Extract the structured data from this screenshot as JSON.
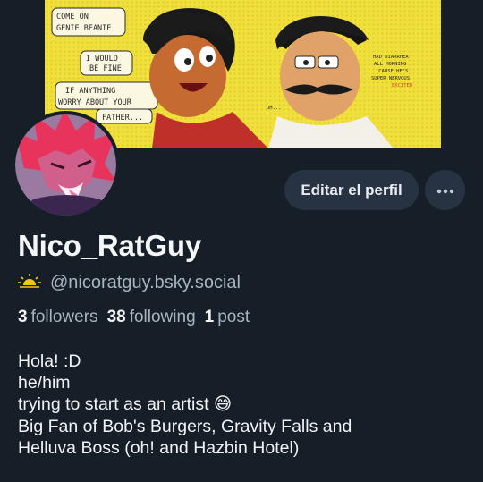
{
  "banner": {
    "bubbles": [
      "COME ON",
      "GENIE BEANIE",
      "I WOULD",
      "BE FINE",
      "IF ANYTHING",
      "WORRY ABOUT YOUR",
      "FATHER..."
    ],
    "side_note": [
      "HAD DIARRHEA",
      "ALL MORNING",
      "'CAUSE HE'S",
      "SUPER NERVOUS",
      "EXCITED"
    ],
    "murmur": "UH..."
  },
  "profile": {
    "display_name": "Nico_RatGuy",
    "handle": "@nicoratguy.bsky.social",
    "handle_icon": "sunrise-icon",
    "edit_label": "Editar el perfil",
    "more_icon": "ellipsis-icon",
    "followers_count": "3",
    "followers_label": "followers",
    "following_count": "38",
    "following_label": "following",
    "posts_count": "1",
    "posts_label": "post"
  },
  "bio": {
    "lines": [
      "Hola! :D",
      "he/him",
      "trying to start as an artist 😅",
      "Big Fan of Bob's Burgers, Gravity Falls and",
      "Helluva Boss (oh! and Hazbin Hotel)"
    ]
  },
  "colors": {
    "background": "#161e27",
    "button": "#273342",
    "muted_text": "#aab4c0",
    "banner_yellow": "#f0e03c",
    "sun_icon": "#f5c518"
  }
}
